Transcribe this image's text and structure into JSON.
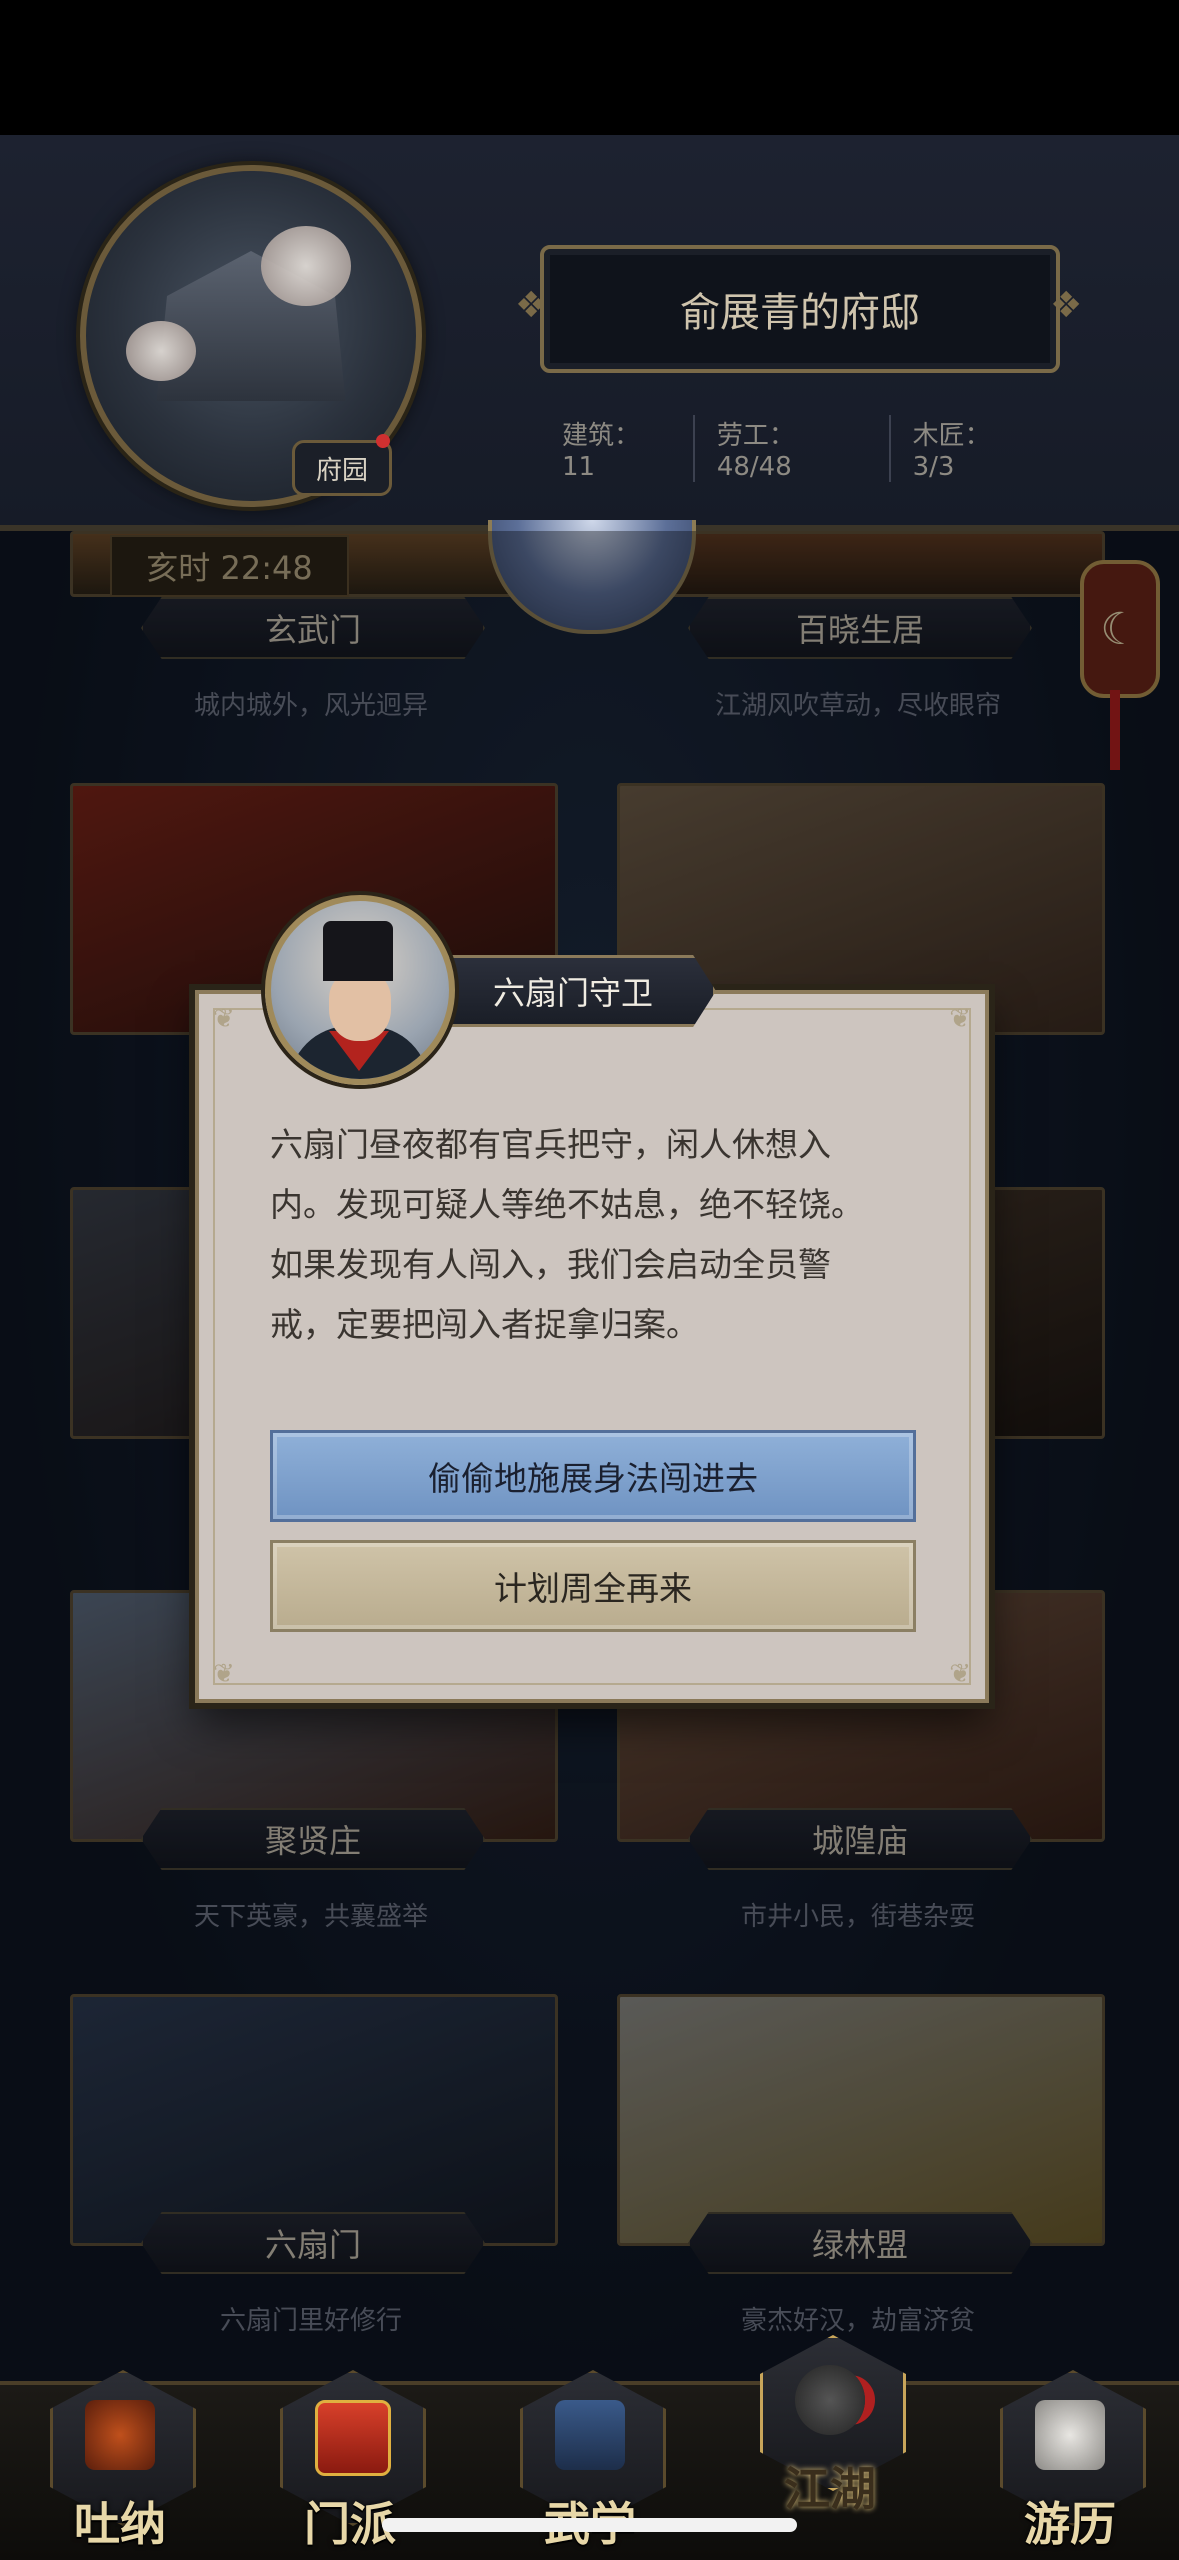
{
  "header": {
    "estate_badge": "府园",
    "estate_title": "俞展青的府邸",
    "stats": [
      "建筑：11",
      "劳工：48/48",
      "木匠：3/3"
    ]
  },
  "map": {
    "time_label": "亥时 22:48",
    "locations": [
      {
        "name": "玄武门",
        "subtitle": "城内城外，风光迥异"
      },
      {
        "name": "百晓生居",
        "subtitle": "江湖风吹草动，尽收眼帘"
      },
      {
        "name": "聚贤庄",
        "subtitle": "天下英豪，共襄盛举"
      },
      {
        "name": "城隍庙",
        "subtitle": "市井小民，街巷杂耍"
      },
      {
        "name": "六扇门",
        "subtitle": "六扇门里好修行"
      },
      {
        "name": "绿林盟",
        "subtitle": "豪杰好汉，劫富济贫"
      }
    ]
  },
  "dialog": {
    "speaker": "六扇门守卫",
    "lines": [
      "六扇门昼夜都有官兵把守，闲人休想入",
      "内。发现可疑人等绝不姑息，绝不轻饶。",
      "如果发现有人闯入，我们会启动全员警",
      "戒，定要把闯入者捉拿归案。"
    ],
    "primary_button": "偷偷地施展身法闯进去",
    "secondary_button": "计划周全再来"
  },
  "bottom_nav": [
    {
      "label": "吐纳",
      "icon": "monk-icon"
    },
    {
      "label": "门派",
      "icon": "banner-icon"
    },
    {
      "label": "武学",
      "icon": "book-icon"
    },
    {
      "label": "江湖",
      "icon": "hat-icon",
      "active": true
    },
    {
      "label": "游历",
      "icon": "horse-icon"
    }
  ],
  "colors": {
    "primary_button": "#8fb0d8",
    "secondary_button": "#cfc3a8",
    "dialog_bg": "#cdc5bf",
    "gold_border": "#8b7a5a"
  }
}
